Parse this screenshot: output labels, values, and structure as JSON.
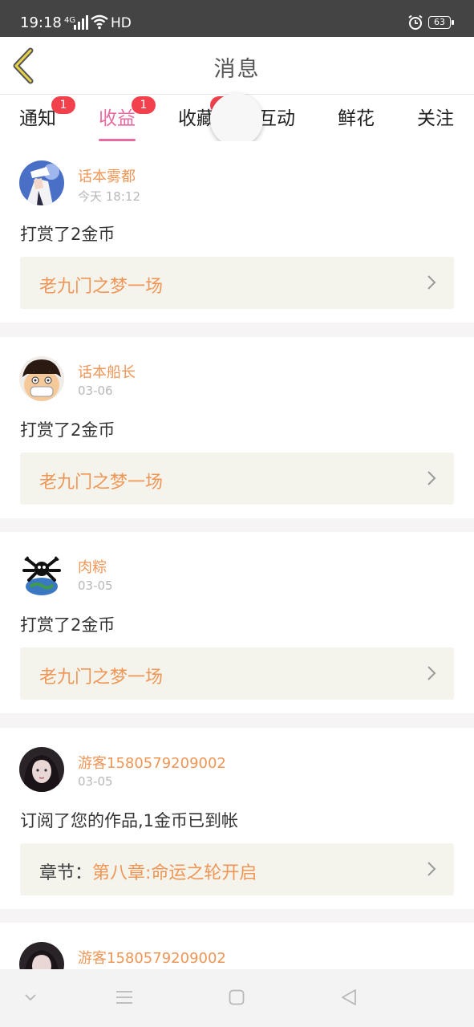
{
  "status_bar": {
    "time": "19:18",
    "network": "4G",
    "hd": "HD",
    "battery": "63"
  },
  "header": {
    "title": "消息",
    "back_icon": "chevron-left-icon"
  },
  "tabs": [
    {
      "label": "通知",
      "badge": "1",
      "active": false
    },
    {
      "label": "收益",
      "badge": "1",
      "active": true
    },
    {
      "label": "收藏",
      "badge": "1",
      "active": false
    },
    {
      "label": "互动",
      "badge": "",
      "active": false
    },
    {
      "label": "鲜花",
      "badge": "",
      "active": false
    },
    {
      "label": "关注",
      "badge": "",
      "active": false
    }
  ],
  "messages": [
    {
      "user": "话本雾都",
      "time": "今天 18:12",
      "text": "打赏了2金币",
      "link_prefix": "",
      "link": "老九门之梦一场",
      "avatar": "anime-character-avatar"
    },
    {
      "user": "话本船长",
      "time": "03-06",
      "text": "打赏了2金币",
      "link_prefix": "",
      "link": "老九门之梦一场",
      "avatar": "cartoon-pirate-avatar"
    },
    {
      "user": "肉粽",
      "time": "03-05",
      "text": "打赏了2金币",
      "link_prefix": "",
      "link": "老九门之梦一场",
      "avatar": "globe-avatar"
    },
    {
      "user": "游客1580579209002",
      "time": "03-05",
      "text": "订阅了您的作品,1金币已到帐",
      "link_prefix": "章节：",
      "link": "第八章:命运之轮开启",
      "avatar": "girl-avatar"
    },
    {
      "user": "游客1580579209002",
      "time": "",
      "text": "",
      "link_prefix": "",
      "link": "",
      "avatar": "girl-avatar"
    }
  ],
  "colors": {
    "accent": "#e96aa0",
    "badge": "#f2414c",
    "username": "#ef9656",
    "link_bg": "#f4f4ec"
  }
}
